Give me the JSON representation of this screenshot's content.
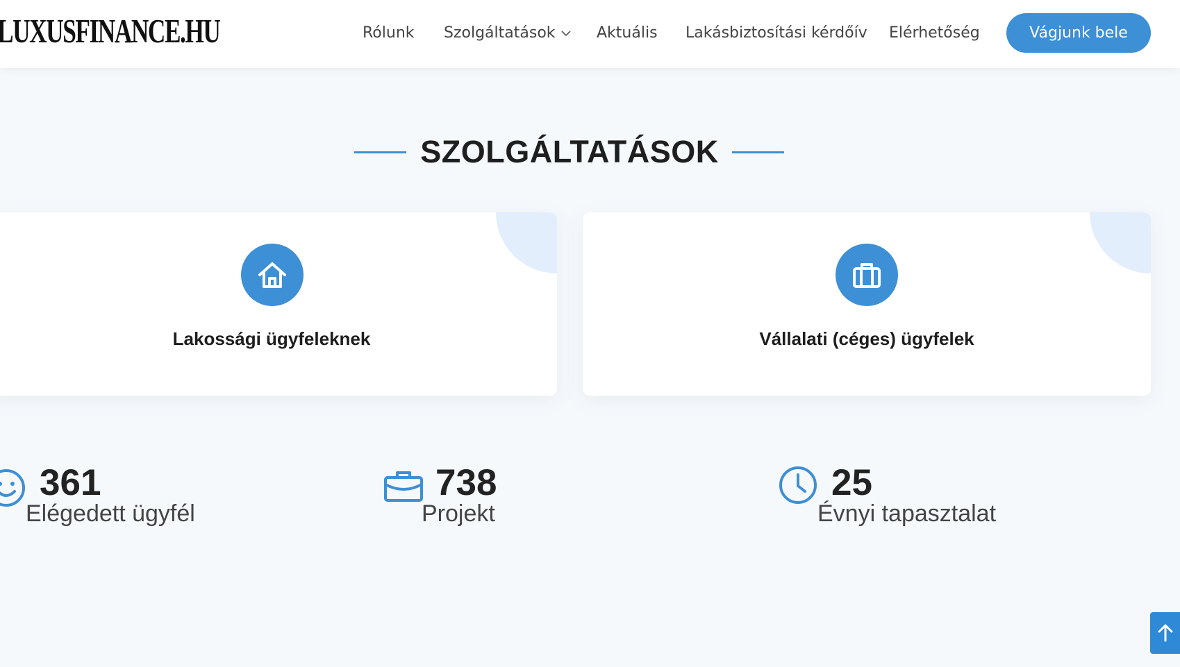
{
  "header": {
    "logo": "LUXUSFINANCE.HU",
    "nav": {
      "rolunk": "Rólunk",
      "szolgaltatasok": "Szolgáltatások",
      "aktualis": "Aktuális",
      "kerdoiv": "Lakásbiztosítási kérdőív",
      "elerhetoseg": "Elérhetőség"
    },
    "cta_label": "Vágjunk bele"
  },
  "services": {
    "title": "SZOLGÁLTATÁSOK",
    "cards": [
      {
        "label": "Lakossági ügyfeleknek",
        "icon": "house-icon"
      },
      {
        "label": "Vállalati (céges) ügyfelek",
        "icon": "briefcase-icon"
      }
    ]
  },
  "stats": [
    {
      "number": "361",
      "label": "Elégedett ügyfél",
      "icon": "smiley-icon"
    },
    {
      "number": "738",
      "label": "Projekt",
      "icon": "briefcase-icon"
    },
    {
      "number": "25",
      "label": "Évnyi tapasztalat",
      "icon": "clock-icon"
    }
  ],
  "colors": {
    "accent": "#3d8fd6",
    "background": "#f6f9fc",
    "card_corner": "#e2eefb"
  }
}
